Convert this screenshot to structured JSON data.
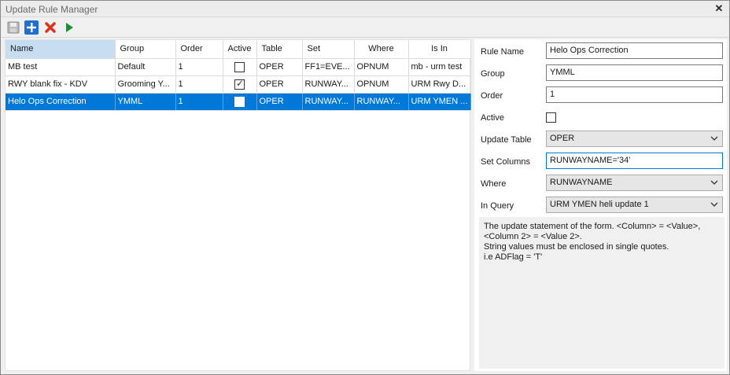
{
  "window": {
    "title": "Update Rule Manager",
    "close_glyph": "✕"
  },
  "toolbar": {
    "items": [
      {
        "name": "save-icon",
        "label": "Save"
      },
      {
        "name": "add-icon",
        "label": "Add"
      },
      {
        "name": "delete-icon",
        "label": "Delete"
      },
      {
        "name": "run-icon",
        "label": "Run"
      }
    ]
  },
  "grid": {
    "columns": [
      "Name",
      "Group",
      "Order",
      "Active",
      "Table",
      "Set",
      "Where",
      "Is In"
    ],
    "rows": [
      {
        "name": "MB test",
        "group": "Default",
        "order": "1",
        "active": false,
        "table": "OPER",
        "set": "FF1=EVE...",
        "where": "OPNUM",
        "isin": "mb - urm test",
        "selected": false
      },
      {
        "name": "RWY blank fix - KDV",
        "group": "Grooming Y...",
        "order": "1",
        "active": true,
        "table": "OPER",
        "set": "RUNWAY...",
        "where": "OPNUM",
        "isin": "URM Rwy D...",
        "selected": false
      },
      {
        "name": "Helo Ops Correction",
        "group": "YMML",
        "order": "1",
        "active": false,
        "table": "OPER",
        "set": "RUNWAY...",
        "where": "RUNWAY...",
        "isin": "URM YMEN ...",
        "selected": true
      }
    ]
  },
  "form": {
    "rule_name_label": "Rule Name",
    "rule_name_value": "Helo Ops Correction",
    "group_label": "Group",
    "group_value": "YMML",
    "order_label": "Order",
    "order_value": "1",
    "active_label": "Active",
    "active_value": false,
    "update_table_label": "Update Table",
    "update_table_value": "OPER",
    "set_columns_label": "Set Columns",
    "set_columns_value": "RUNWAYNAME='34'",
    "where_label": "Where",
    "where_value": "RUNWAYNAME",
    "in_query_label": "In Query",
    "in_query_value": "URM YMEN heli update 1"
  },
  "description": {
    "lines": [
      "The update statement of the form. <Column> = <Value>,",
      "<Column 2> = <Value 2>.",
      "String values must be enclosed in single quotes.",
      "i.e ADFlag = 'T'"
    ]
  },
  "colors": {
    "selection": "#0078d7",
    "header_selected": "#c7ddf2",
    "add_icon": "#1f6fd1",
    "delete_icon": "#d9341c",
    "run_icon": "#1e8a3a"
  }
}
